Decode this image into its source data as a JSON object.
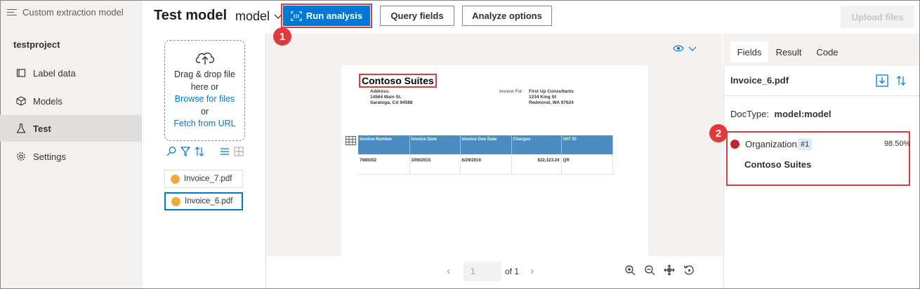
{
  "app": {
    "title": "Custom extraction model",
    "project": "testproject"
  },
  "nav": [
    {
      "label": "Label data",
      "icon": "label-icon"
    },
    {
      "label": "Models",
      "icon": "cube-icon"
    },
    {
      "label": "Test",
      "icon": "flask-icon",
      "active": true
    },
    {
      "label": "Settings",
      "icon": "gear-icon"
    }
  ],
  "header": {
    "title": "Test model",
    "model_select": "model",
    "upload_button": "Upload files"
  },
  "dropzone": {
    "line1": "Drag & drop file",
    "line2": "here or",
    "browse": "Browse for files",
    "or": "or",
    "fetch": "Fetch from URL"
  },
  "files": [
    {
      "name": "Invoice_7.pdf",
      "selected": false
    },
    {
      "name": "Invoice_6.pdf",
      "selected": true
    }
  ],
  "toolbar": {
    "run": "Run analysis",
    "query": "Query fields",
    "analyze": "Analyze options"
  },
  "callouts": {
    "one": "1",
    "two": "2"
  },
  "document": {
    "title": "Contoso Suites",
    "address_label": "Address:",
    "address_line1": "14564 Main St.",
    "address_line2": "Saratoga, CA 94588",
    "invoice_for_label": "Invoice For:",
    "invoice_for_name": "First Up Consultants",
    "invoice_for_line1": "1234 King St",
    "invoice_for_line2": "Redmond, WA 97624",
    "table": {
      "headers": [
        "Invoice Number",
        "Invoice Date",
        "Invoice Due Date",
        "Charges",
        "VAT ID"
      ],
      "row": [
        "7689302",
        "3/09/2015",
        "6/29/2016",
        "$22,123.24",
        "QR"
      ]
    }
  },
  "pager": {
    "page": "1",
    "of": "of 1"
  },
  "right_panel": {
    "tabs": [
      "Fields",
      "Result",
      "Code"
    ],
    "active_tab": "Fields",
    "file": "Invoice_6.pdf",
    "doctype_label": "DocType:",
    "doctype_value": "model:model",
    "field": {
      "name": "Organization",
      "tag": "#1",
      "confidence": "98.50%",
      "value": "Contoso Suites"
    }
  },
  "colors": {
    "accent": "#0078d4",
    "callout": "#e03a3a",
    "field_dot": "#c4262e",
    "file_dot": "#f2a93b"
  }
}
